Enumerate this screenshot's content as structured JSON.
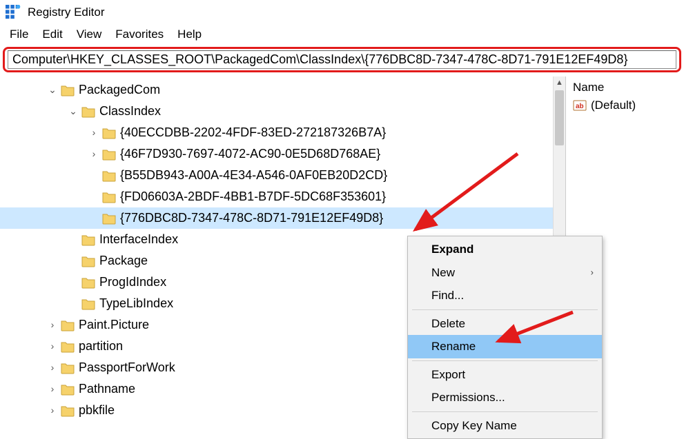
{
  "app": {
    "title": "Registry Editor"
  },
  "menubar": {
    "items": [
      "File",
      "Edit",
      "View",
      "Favorites",
      "Help"
    ]
  },
  "address": {
    "value": "Computer\\HKEY_CLASSES_ROOT\\PackagedCom\\ClassIndex\\{776DBC8D-7347-478C-8D71-791E12EF49D8}"
  },
  "tree": {
    "nodes": [
      {
        "indent": 2,
        "twisty": "open",
        "label": "PackagedCom",
        "selected": false
      },
      {
        "indent": 3,
        "twisty": "open",
        "label": "ClassIndex",
        "selected": false
      },
      {
        "indent": 4,
        "twisty": "closed",
        "label": "{40ECCDBB-2202-4FDF-83ED-272187326B7A}",
        "selected": false
      },
      {
        "indent": 4,
        "twisty": "closed",
        "label": "{46F7D930-7697-4072-AC90-0E5D68D768AE}",
        "selected": false
      },
      {
        "indent": 4,
        "twisty": "none",
        "label": "{B55DB943-A00A-4E34-A546-0AF0EB20D2CD}",
        "selected": false
      },
      {
        "indent": 4,
        "twisty": "none",
        "label": "{FD06603A-2BDF-4BB1-B7DF-5DC68F353601}",
        "selected": false
      },
      {
        "indent": 4,
        "twisty": "none",
        "label": "{776DBC8D-7347-478C-8D71-791E12EF49D8}",
        "selected": true
      },
      {
        "indent": 3,
        "twisty": "none",
        "label": "InterfaceIndex",
        "selected": false
      },
      {
        "indent": 3,
        "twisty": "none",
        "label": "Package",
        "selected": false
      },
      {
        "indent": 3,
        "twisty": "none",
        "label": "ProgIdIndex",
        "selected": false
      },
      {
        "indent": 3,
        "twisty": "none",
        "label": "TypeLibIndex",
        "selected": false
      },
      {
        "indent": 2,
        "twisty": "closed",
        "label": "Paint.Picture",
        "selected": false
      },
      {
        "indent": 2,
        "twisty": "closed",
        "label": "partition",
        "selected": false
      },
      {
        "indent": 2,
        "twisty": "closed",
        "label": "PassportForWork",
        "selected": false
      },
      {
        "indent": 2,
        "twisty": "closed",
        "label": "Pathname",
        "selected": false
      },
      {
        "indent": 2,
        "twisty": "closed",
        "label": "pbkfile",
        "selected": false
      }
    ]
  },
  "right": {
    "column_header": "Name",
    "values": [
      {
        "name": "(Default)"
      }
    ]
  },
  "context_menu": {
    "items": [
      {
        "label": "Expand",
        "bold": true,
        "type": "item"
      },
      {
        "label": "New",
        "type": "submenu"
      },
      {
        "label": "Find...",
        "type": "item"
      },
      {
        "type": "sep"
      },
      {
        "label": "Delete",
        "type": "item"
      },
      {
        "label": "Rename",
        "type": "item",
        "highlight": true
      },
      {
        "type": "sep"
      },
      {
        "label": "Export",
        "type": "item"
      },
      {
        "label": "Permissions...",
        "type": "item"
      },
      {
        "type": "sep"
      },
      {
        "label": "Copy Key Name",
        "type": "item"
      }
    ]
  }
}
